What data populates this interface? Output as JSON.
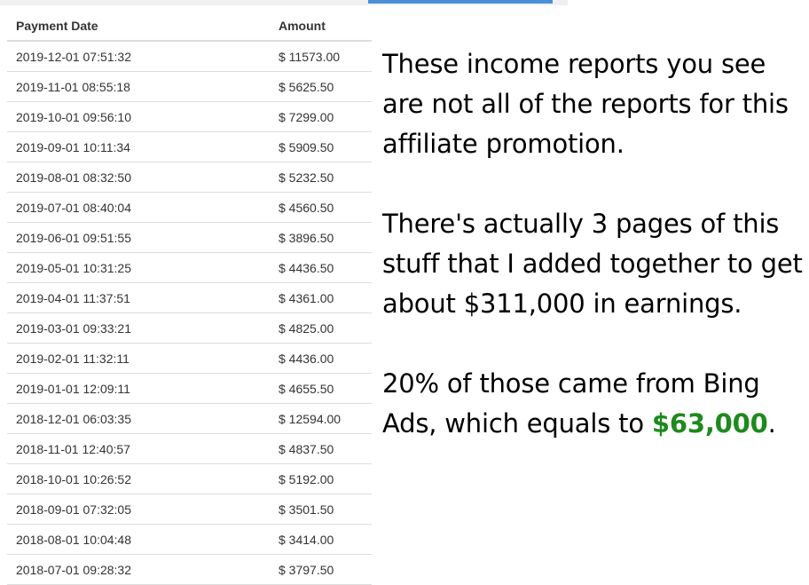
{
  "table": {
    "headers": [
      "Payment Date",
      "Amount"
    ],
    "rows": [
      [
        "2019-12-01 07:51:32",
        "$ 11573.00"
      ],
      [
        "2019-11-01 08:55:18",
        "$ 5625.50"
      ],
      [
        "2019-10-01 09:56:10",
        "$ 7299.00"
      ],
      [
        "2019-09-01 10:11:34",
        "$ 5909.50"
      ],
      [
        "2019-08-01 08:32:50",
        "$ 5232.50"
      ],
      [
        "2019-07-01 08:40:04",
        "$ 4560.50"
      ],
      [
        "2019-06-01 09:51:55",
        "$ 3896.50"
      ],
      [
        "2019-05-01 10:31:25",
        "$ 4436.50"
      ],
      [
        "2019-04-01 11:37:51",
        "$ 4361.00"
      ],
      [
        "2019-03-01 09:33:21",
        "$ 4825.00"
      ],
      [
        "2019-02-01 11:32:11",
        "$ 4436.00"
      ],
      [
        "2019-01-01 12:09:11",
        "$ 4655.50"
      ],
      [
        "2018-12-01 06:03:35",
        "$ 12594.00"
      ],
      [
        "2018-11-01 12:40:57",
        "$ 4837.50"
      ],
      [
        "2018-10-01 10:26:52",
        "$ 5192.00"
      ],
      [
        "2018-09-01 07:32:05",
        "$ 3501.50"
      ],
      [
        "2018-08-01 10:04:48",
        "$ 3414.00"
      ],
      [
        "2018-07-01 09:28:32",
        "$ 3797.50"
      ]
    ]
  },
  "note": {
    "paragraph1": "These income reports you see are not all of the reports for this affiliate promotion.",
    "paragraph2": "There's actually 3 pages of this stuff that I added together to get about $311,000 in earnings.",
    "paragraph3_prefix": "20% of those came from Bing Ads, which equals to ",
    "paragraph3_highlight": "$63,000",
    "paragraph3_suffix": "."
  },
  "colors": {
    "highlight": "#1e8a1e",
    "accent_bar": "#4a90d9"
  }
}
